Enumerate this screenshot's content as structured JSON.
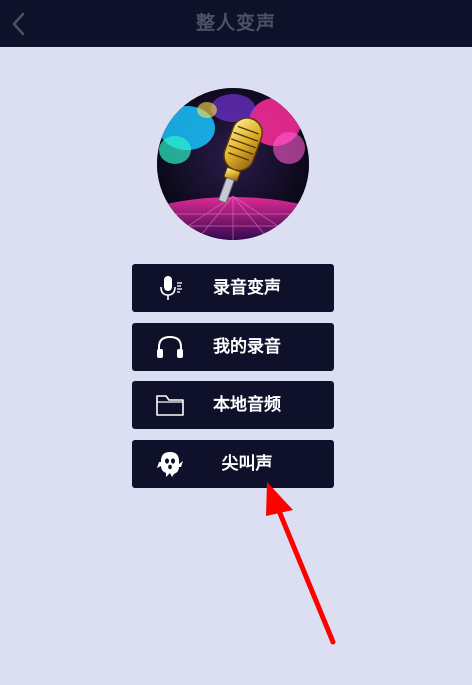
{
  "header": {
    "title": "整人变声",
    "back_icon": "chevron-left-icon"
  },
  "menu": [
    {
      "label": "录音变声",
      "icon": "microphone-icon"
    },
    {
      "label": "我的录音",
      "icon": "headphones-icon"
    },
    {
      "label": "本地音频",
      "icon": "folder-icon"
    },
    {
      "label": "尖叫声",
      "icon": "ghost-icon"
    }
  ],
  "colors": {
    "background": "#dcdff1",
    "bar": "#0e1129",
    "button_text": "#ffffff",
    "title_text": "#4d5066",
    "annotation_arrow": "#ff0000"
  }
}
